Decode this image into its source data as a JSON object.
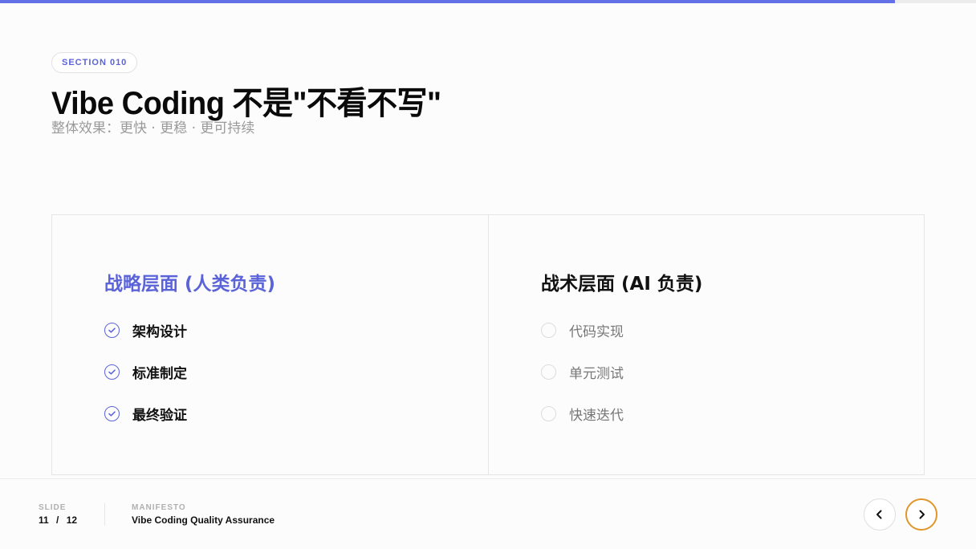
{
  "progress": {
    "fraction": 0.9167,
    "fill_color": "#6470e6"
  },
  "header": {
    "section_label": "SECTION 010",
    "title": "Vibe Coding 不是\"不看不写\"",
    "subtitle": "整体效果：更快 · 更稳 · 更可持续"
  },
  "columns": [
    {
      "heading": "战略层面 (人类负责)",
      "accent_color": "#5b63d9",
      "items": [
        {
          "label": "架构设计",
          "icon": "check-circle-icon"
        },
        {
          "label": "标准制定",
          "icon": "check-circle-icon"
        },
        {
          "label": "最终验证",
          "icon": "check-circle-icon"
        }
      ]
    },
    {
      "heading": "战术层面 (AI 负责)",
      "items": [
        {
          "label": "代码实现",
          "icon": "empty-circle-icon"
        },
        {
          "label": "单元测试",
          "icon": "empty-circle-icon"
        },
        {
          "label": "快速迭代",
          "icon": "empty-circle-icon"
        }
      ]
    }
  ],
  "footer": {
    "slide_caption": "SLIDE",
    "slide_current": "11",
    "slide_separator": "/",
    "slide_total": "12",
    "deck_caption": "MANIFESTO",
    "deck_title": "Vibe Coding Quality Assurance",
    "prev_icon": "chevron-left-icon",
    "next_icon": "chevron-right-icon",
    "next_ring_color": "#e0962a"
  }
}
